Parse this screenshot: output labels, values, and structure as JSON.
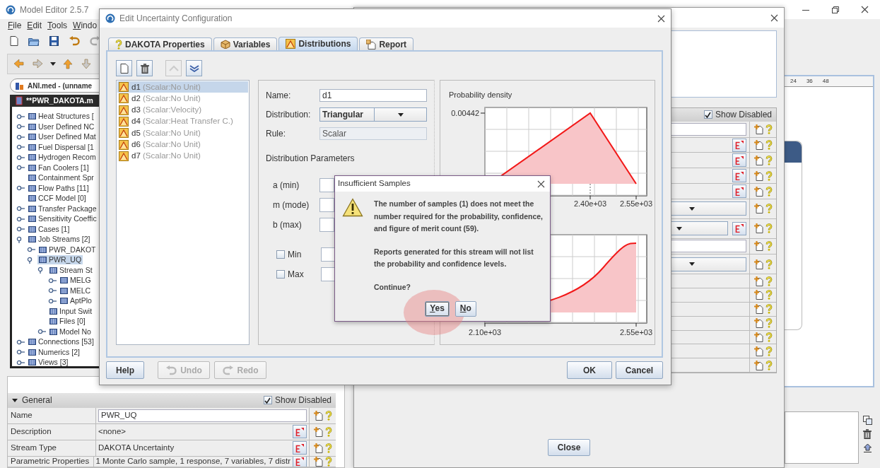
{
  "app": {
    "title": "Model Editor 2.5.7",
    "menu": [
      "File",
      "Edit",
      "Tools",
      "Windo"
    ],
    "file_tab": "ANI.med - (unname",
    "model_header": "**PWR_DAKOTA.m",
    "tree": [
      {
        "label": "Heat Structures [",
        "expanded": false,
        "selected": false
      },
      {
        "label": "User Defined NC",
        "expanded": false,
        "selected": false
      },
      {
        "label": "User Defined Mat",
        "expanded": false,
        "selected": false
      },
      {
        "label": "Fuel Dispersal [1",
        "expanded": false,
        "selected": false
      },
      {
        "label": "Hydrogen Recom",
        "expanded": false,
        "selected": false
      },
      {
        "label": "Fan Coolers [1]",
        "expanded": false,
        "selected": false
      },
      {
        "label": "Containment Spr",
        "selected": false
      },
      {
        "label": "Flow Paths [11]",
        "expanded": false,
        "selected": false
      },
      {
        "label": "CCF Model [0]",
        "selected": false
      },
      {
        "label": "Transfer Package",
        "expanded": false,
        "selected": false
      },
      {
        "label": "Sensitivity Coeffic",
        "expanded": false,
        "selected": false
      },
      {
        "label": "Cases [1]",
        "expanded": false,
        "selected": false
      },
      {
        "label": "Job Streams [2]",
        "expanded": true,
        "selected": false,
        "children": [
          {
            "label": "PWR_DAKOT",
            "expanded": false,
            "selected": false
          },
          {
            "label": "PWR_UQ",
            "expanded": true,
            "selected": true,
            "children": [
              {
                "label": "Stream St",
                "expanded": true,
                "selected": false,
                "children": [
                  {
                    "label": "MELG",
                    "expanded": false,
                    "selected": false
                  },
                  {
                    "label": "MELC",
                    "expanded": false,
                    "selected": false
                  },
                  {
                    "label": "AptPlo",
                    "expanded": false,
                    "selected": false
                  }
                ]
              },
              {
                "label": "Input Swit",
                "selected": false
              },
              {
                "label": "Files [0]",
                "selected": false
              },
              {
                "label": "Model No",
                "expanded": false,
                "selected": false
              }
            ]
          }
        ]
      },
      {
        "label": "Connections [53]",
        "expanded": false,
        "selected": false
      },
      {
        "label": "Numerics [2]",
        "expanded": false,
        "selected": false
      },
      {
        "label": "Views [3]",
        "expanded": false,
        "selected": false
      }
    ],
    "properties": {
      "section": "General",
      "show_disabled": {
        "label": "Show Disabled",
        "checked": true
      },
      "rows": [
        {
          "label": "Name",
          "value": "PWR_UQ",
          "kind": "field"
        },
        {
          "label": "Description",
          "value": "<none>",
          "kind": "edit"
        },
        {
          "label": "Stream Type",
          "value": "DAKOTA Uncertainty",
          "kind": "edit"
        },
        {
          "label": "Parametric Properties",
          "value": "1 Monte Carlo sample, 1 response, 7 variables, 7 distr",
          "kind": "edit"
        }
      ]
    },
    "ruler": [
      "24",
      "36",
      "48"
    ]
  },
  "background_window": {
    "show_disabled": {
      "label": "Show Disabled",
      "checked": true
    },
    "rows": [
      {
        "kind": "field"
      },
      {
        "kind": "edit"
      },
      {
        "kind": "edit"
      },
      {
        "kind": "edit"
      },
      {
        "kind": "edit"
      },
      {
        "kind": "select"
      },
      {
        "kind": "select-edit"
      },
      {
        "kind": "field"
      },
      {
        "kind": "select"
      },
      {
        "kind": "plain"
      },
      {
        "kind": "plain"
      },
      {
        "kind": "plain"
      },
      {
        "kind": "plain"
      },
      {
        "kind": "plain"
      },
      {
        "kind": "plain"
      },
      {
        "kind": "plain"
      }
    ],
    "close_button": "Close"
  },
  "dialog": {
    "title": "Edit Uncertainty Configuration",
    "tabs": [
      {
        "label": "DAKOTA Properties",
        "kind": "help",
        "selected": false
      },
      {
        "label": "Variables",
        "kind": "box",
        "selected": false
      },
      {
        "label": "Distributions",
        "kind": "distribution",
        "selected": true
      },
      {
        "label": "Report",
        "kind": "report",
        "selected": false
      }
    ],
    "toolbar": [
      {
        "kind": "new",
        "disabled": false
      },
      {
        "kind": "delete",
        "disabled": false
      },
      {
        "kind": "up",
        "disabled": true
      },
      {
        "kind": "down",
        "disabled": false
      }
    ],
    "distributions": [
      {
        "name": "d1",
        "unit": "(Scalar:No Unit)",
        "selected": true
      },
      {
        "name": "d2",
        "unit": "(Scalar:No Unit)",
        "selected": false
      },
      {
        "name": "d3",
        "unit": "(Scalar:Velocity)",
        "selected": false
      },
      {
        "name": "d4",
        "unit": "(Scalar:Heat Transfer C.)",
        "selected": false
      },
      {
        "name": "d5",
        "unit": "(Scalar:No Unit)",
        "selected": false
      },
      {
        "name": "d6",
        "unit": "(Scalar:No Unit)",
        "selected": false
      },
      {
        "name": "d7",
        "unit": "(Scalar:No Unit)",
        "selected": false
      }
    ],
    "form": {
      "name_label": "Name:",
      "name_value": "d1",
      "distribution_label": "Distribution:",
      "distribution_value": "Triangular",
      "rule_label": "Rule:",
      "rule_value": "Scalar",
      "params_heading": "Distribution Parameters",
      "params": [
        {
          "label": "a (min)"
        },
        {
          "label": "m (mode)"
        },
        {
          "label": "b (max)"
        }
      ],
      "bounds": [
        {
          "label": "Min",
          "checked": false
        },
        {
          "label": "Max",
          "checked": false
        }
      ]
    },
    "density_chart": {
      "title": "Probability density",
      "y_tick": "0.00442",
      "x_ticks": [
        "2.40e+03",
        "2.55e+03"
      ]
    },
    "cumulative_chart": {
      "x_ticks": [
        "2.10e+03",
        "2.55e+03"
      ]
    },
    "footer_left": [
      {
        "label": "Help",
        "kind": "plain",
        "disabled": false
      },
      {
        "label": "Undo",
        "kind": "undo",
        "disabled": true
      },
      {
        "label": "Redo",
        "kind": "redo",
        "disabled": true
      }
    ],
    "footer_right": [
      {
        "label": "OK"
      },
      {
        "label": "Cancel"
      }
    ]
  },
  "alert": {
    "title": "Insufficient Samples",
    "paragraphs": [
      "The number of samples (1) does not meet the\nnumber required for the probability, confidence,\nand figure of merit count (59).",
      "Reports generated for this stream will not list\nthe probability and confidence levels.",
      "Continue?"
    ],
    "buttons": [
      {
        "label": "Yes",
        "highlighted": true
      },
      {
        "label": "No",
        "highlighted": false
      }
    ]
  }
}
